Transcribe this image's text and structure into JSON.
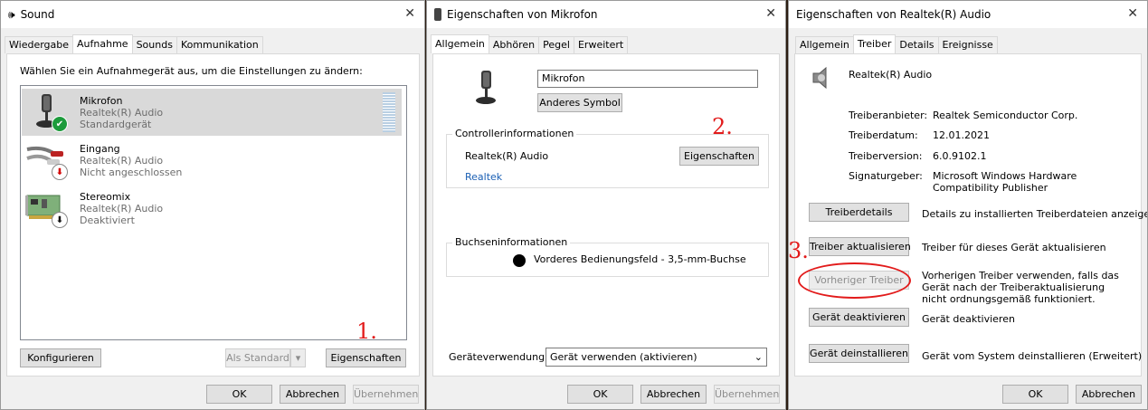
{
  "win1": {
    "title": "Sound",
    "tabs": [
      "Wiedergabe",
      "Aufnahme",
      "Sounds",
      "Kommunikation"
    ],
    "instruction": "Wählen Sie ein Aufnahmegerät aus, um die Einstellungen zu ändern:",
    "devices": [
      {
        "name": "Mikrofon",
        "driver": "Realtek(R) Audio",
        "status": "Standardgerät",
        "icon": "microphone-icon",
        "badge": "check-badge-icon"
      },
      {
        "name": "Eingang",
        "driver": "Realtek(R) Audio",
        "status": "Nicht angeschlossen",
        "icon": "audio-jack-icon",
        "badge": "down-arrow-red-badge-icon"
      },
      {
        "name": "Stereomix",
        "driver": "Realtek(R) Audio",
        "status": "Deaktiviert",
        "icon": "sound-card-icon",
        "badge": "down-arrow-black-badge-icon"
      }
    ],
    "configure_label": "Konfigurieren",
    "set_default_label": "Als Standard",
    "properties_label": "Eigenschaften",
    "ok_label": "OK",
    "cancel_label": "Abbrechen",
    "apply_label": "Übernehmen",
    "annotation": "1."
  },
  "win2": {
    "title": "Eigenschaften von Mikrofon",
    "tabs": [
      "Allgemein",
      "Abhören",
      "Pegel",
      "Erweitert"
    ],
    "name_value": "Mikrofon",
    "change_icon_label": "Anderes Symbol",
    "controller_legend": "Controllerinformationen",
    "controller_name": "Realtek(R) Audio",
    "controller_vendor": "Realtek",
    "controller_properties_label": "Eigenschaften",
    "jack_legend": "Buchseninformationen",
    "jack_text": "Vorderes Bedienungsfeld - 3,5-mm-Buchse",
    "usage_label": "Geräteverwendung:",
    "usage_value": "Gerät verwenden (aktivieren)",
    "ok_label": "OK",
    "cancel_label": "Abbrechen",
    "apply_label": "Übernehmen",
    "annotation": "2."
  },
  "win3": {
    "title": "Eigenschaften von Realtek(R) Audio",
    "tabs": [
      "Allgemein",
      "Treiber",
      "Details",
      "Ereignisse"
    ],
    "device_name": "Realtek(R) Audio",
    "info": [
      {
        "key": "Treiberanbieter:",
        "value": "Realtek Semiconductor Corp."
      },
      {
        "key": "Treiberdatum:",
        "value": "12.01.2021"
      },
      {
        "key": "Treiberversion:",
        "value": "6.0.9102.1"
      },
      {
        "key": "Signaturgeber:",
        "value": "Microsoft Windows Hardware Compatibility Publisher"
      }
    ],
    "actions": [
      {
        "label": "Treiberdetails",
        "desc": "Details zu installierten Treiberdateien anzeigen"
      },
      {
        "label": "Treiber aktualisieren",
        "desc": "Treiber für dieses Gerät aktualisieren"
      },
      {
        "label": "Vorheriger Treiber",
        "desc": "Vorherigen Treiber verwenden, falls das Gerät nach der Treiberaktualisierung nicht ordnungsgemäß funktioniert."
      },
      {
        "label": "Gerät deaktivieren",
        "desc": "Gerät deaktivieren"
      },
      {
        "label": "Gerät deinstallieren",
        "desc": "Gerät vom System deinstallieren (Erweitert)"
      }
    ],
    "ok_label": "OK",
    "cancel_label": "Abbrechen",
    "annotation": "3.",
    "highlight_color": "#e21b1b"
  },
  "colors": {
    "accent_link": "#1a5fb4",
    "selected_row": "#d9d9d9",
    "annotation": "#e21b1b"
  }
}
